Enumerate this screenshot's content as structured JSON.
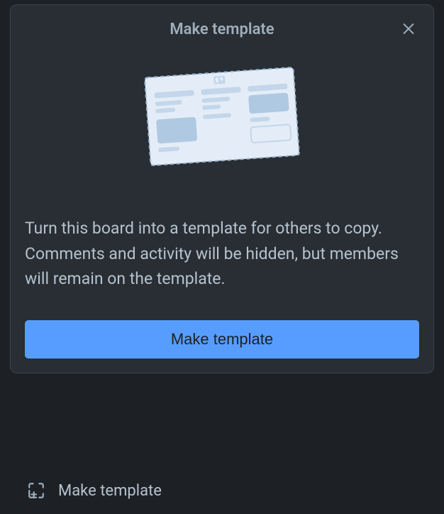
{
  "dialog": {
    "title": "Make template",
    "description": "Turn this board into a template for others to copy. Comments and activity will be hidden, but members will remain on the template.",
    "primary_button": "Make template"
  },
  "footer": {
    "label": "Make template"
  }
}
